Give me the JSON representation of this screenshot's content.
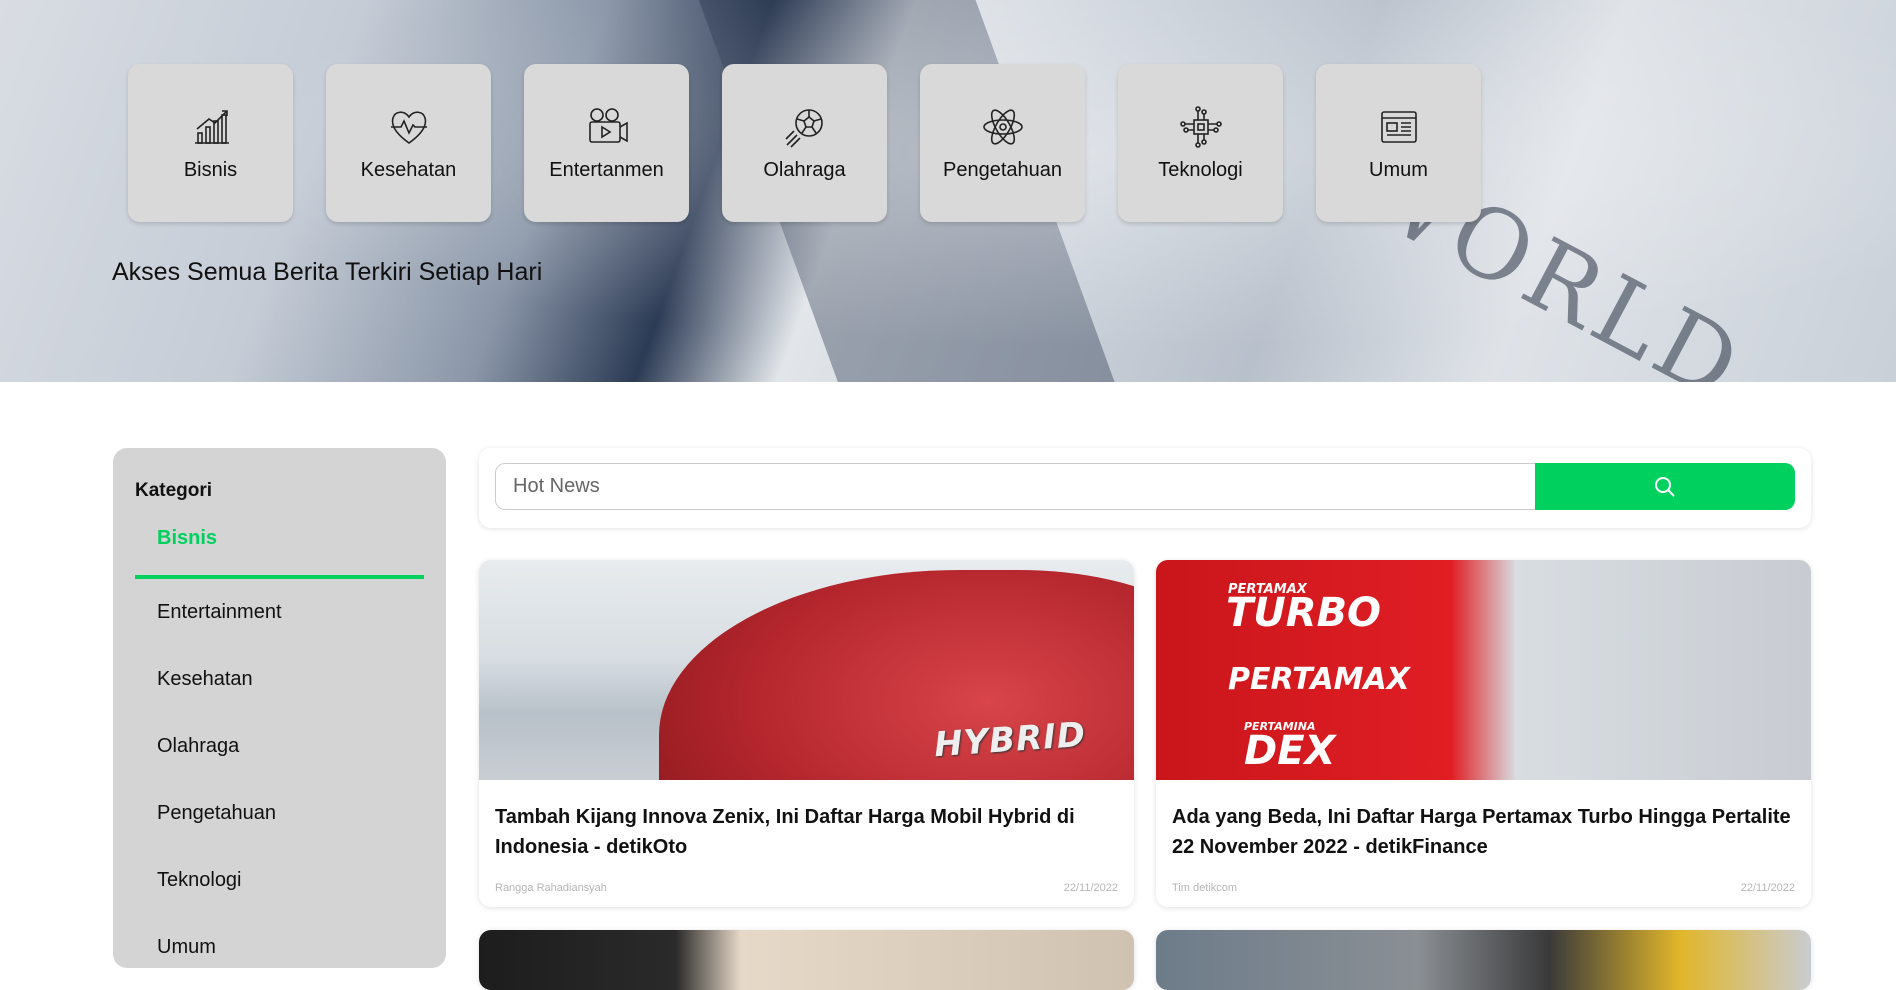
{
  "hero": {
    "background_text": "WORLD",
    "tagline": "Akses Semua Berita Terkiri Setiap Hari",
    "categories": [
      {
        "label": "Bisnis",
        "icon": "chart-growth-icon"
      },
      {
        "label": "Kesehatan",
        "icon": "heart-pulse-icon"
      },
      {
        "label": "Entertanmen",
        "icon": "film-camera-icon"
      },
      {
        "label": "Olahraga",
        "icon": "soccer-ball-icon"
      },
      {
        "label": "Pengetahuan",
        "icon": "atom-icon"
      },
      {
        "label": "Teknologi",
        "icon": "circuit-chip-icon"
      },
      {
        "label": "Umum",
        "icon": "newspaper-icon"
      }
    ]
  },
  "sidebar": {
    "title": "Kategori",
    "items": [
      {
        "label": "Bisnis",
        "active": true
      },
      {
        "label": "Entertainment",
        "active": false
      },
      {
        "label": "Kesehatan",
        "active": false
      },
      {
        "label": "Olahraga",
        "active": false
      },
      {
        "label": "Pengetahuan",
        "active": false
      },
      {
        "label": "Teknologi",
        "active": false
      },
      {
        "label": "Umum",
        "active": false
      }
    ]
  },
  "search": {
    "placeholder": "Hot News",
    "value": "",
    "button_icon": "search-icon"
  },
  "news": [
    {
      "image_text": "HYBRID",
      "title": "Tambah Kijang Innova Zenix, Ini Daftar Harga Mobil Hybrid di Indonesia - detikOto",
      "author": "Rangga Rahadiansyah",
      "date": "22/11/2022"
    },
    {
      "image_text": [
        "PERTAMAX",
        "TURBO",
        "PERTAMAX",
        "PERTAMINA",
        "DEX"
      ],
      "title": "Ada yang Beda, Ini Daftar Harga Pertamax Turbo Hingga Pertalite 22 November 2022 - detikFinance",
      "author": "Tim detikcom",
      "date": "22/11/2022"
    }
  ],
  "colors": {
    "accent": "#00d15e",
    "card_gray": "#d9d9d9",
    "sidebar_gray": "#d4d4d4"
  }
}
